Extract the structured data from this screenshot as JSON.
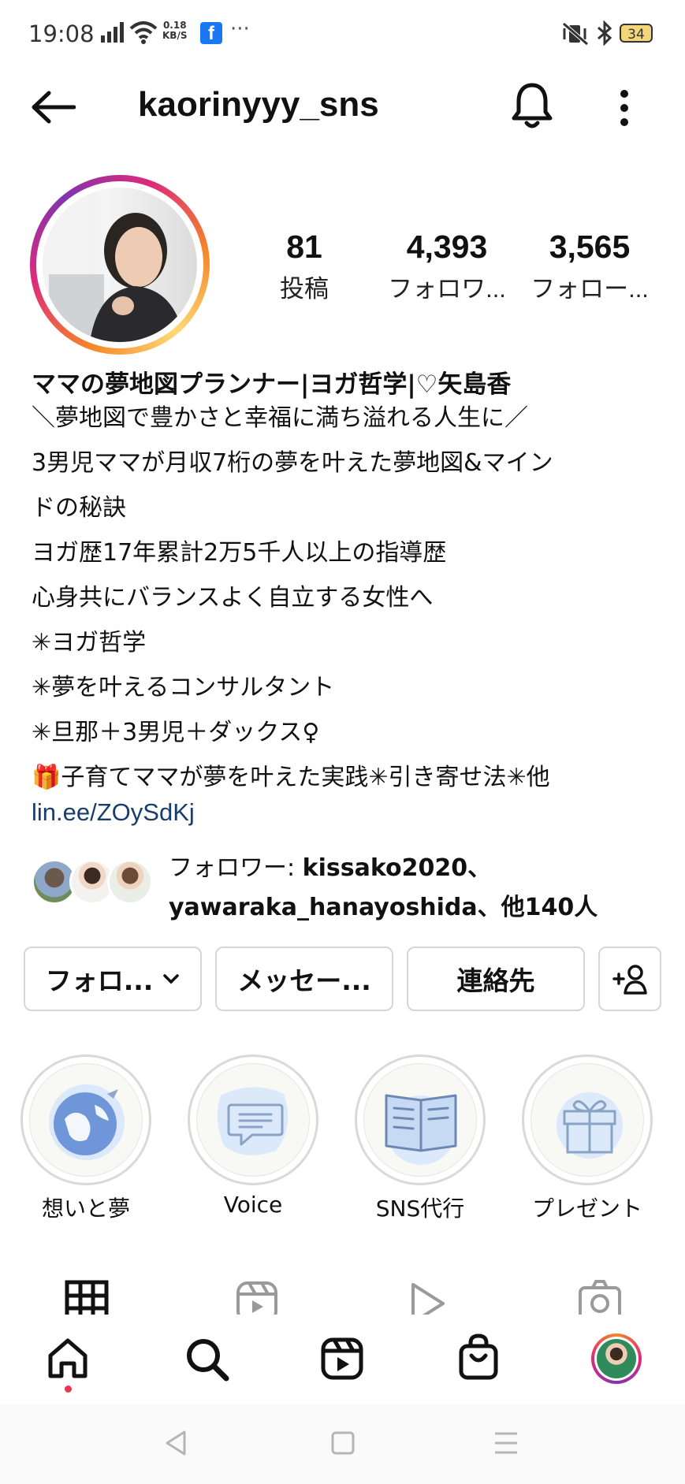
{
  "status_bar": {
    "time": "19:08",
    "net_speed_value": "0.18",
    "net_speed_unit": "KB/S",
    "fb_label": "f",
    "more": "···",
    "battery": "34"
  },
  "header": {
    "username": "kaorinyyy_sns"
  },
  "stats": [
    {
      "number": "81",
      "label": "投稿"
    },
    {
      "number": "4,393",
      "label": "フォロワ..."
    },
    {
      "number": "3,565",
      "label": "フォロー..."
    }
  ],
  "bio": {
    "name": "ママの夢地図プランナー|ヨガ哲学|♡矢島香",
    "lines": [
      "＼夢地図で豊かさと幸福に満ち溢れる人生に／",
      "3男児ママが月収7桁の夢を叶えた夢地図&マイン",
      "ドの秘訣",
      "ヨガ歴17年累計2万5千人以上の指導歴",
      "心身共にバランスよく自立する女性へ",
      "✳ヨガ哲学",
      "✳夢を叶えるコンサルタント",
      "✳旦那＋3男児＋ダックス♀",
      "🎁子育てママが夢を叶えた実践✳引き寄せ法✳他"
    ],
    "link": "lin.ee/ZOySdKj"
  },
  "followed_by": {
    "prefix": "フォロワー: ",
    "user1": "kissako2020",
    "sep": "、",
    "user2": "yawaraka_hanayoshida",
    "suffix": "、他140人"
  },
  "buttons": {
    "follow": "フォロ...",
    "message": "メッセー...",
    "contact": "連絡先"
  },
  "highlights": [
    {
      "label": "想いと夢",
      "icon": "globe-icon"
    },
    {
      "label": "Voice",
      "icon": "chat-bubble-icon"
    },
    {
      "label": "SNS代行",
      "icon": "open-book-icon"
    },
    {
      "label": "プレゼント",
      "icon": "gift-icon"
    }
  ],
  "colors": {
    "link": "#1a3d6e",
    "story_ring": "#dd2a7b",
    "highlight_blue": "#dbe9fb",
    "notification_dot": "#e8364f"
  }
}
